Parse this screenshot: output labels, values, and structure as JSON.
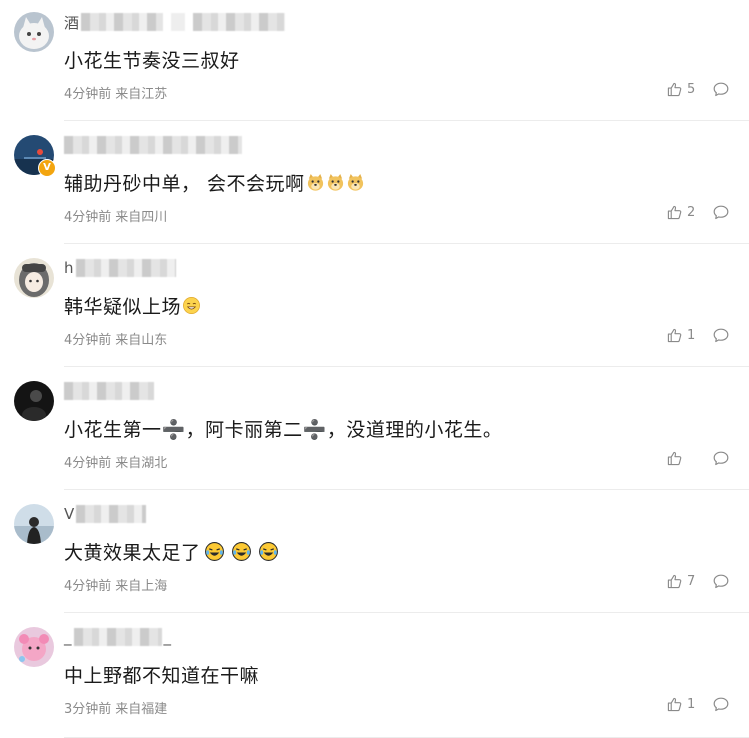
{
  "colors": {
    "text_primary": "#1a1a1a",
    "meta_gray": "#8a8a8a",
    "divider": "#ececec",
    "verified_badge": "#f3a50f"
  },
  "comments": [
    {
      "username_lead": "酒",
      "body": "小花生节奏没三叔好",
      "emojis": [],
      "time": "4分钟前",
      "location": "来自江苏",
      "likes": "5",
      "avatar_icon": "white-cat-avatar",
      "verified": false
    },
    {
      "username_lead": "",
      "body": "辅助丹砂中单， 会不会玩啊",
      "emojis": [
        "doge-icon",
        "doge-icon",
        "doge-icon"
      ],
      "time": "4分钟前",
      "location": "来自四川",
      "likes": "2",
      "avatar_icon": "blue-sky-avatar",
      "verified": true
    },
    {
      "username_lead": "h",
      "body": "韩华疑似上场",
      "emojis": [
        "grin-icon"
      ],
      "time": "4分钟前",
      "location": "来自山东",
      "likes": "1",
      "avatar_icon": "anime-girl-avatar",
      "verified": false
    },
    {
      "username_lead": "",
      "body": "小花生第一➗，阿卡丽第二➗，没道理的小花生。",
      "emojis": [],
      "time": "4分钟前",
      "location": "来自湖北",
      "likes": "",
      "avatar_icon": "dark-avatar",
      "verified": false
    },
    {
      "username_lead": "V",
      "body": "大黄效果太足了",
      "emojis": [
        "laugh-cry-icon",
        "laugh-cry-icon",
        "laugh-cry-icon"
      ],
      "time": "4分钟前",
      "location": "来自上海",
      "likes": "7",
      "avatar_icon": "beach-avatar",
      "verified": false
    },
    {
      "username_lead": "_",
      "body": "中上野都不知道在干嘛",
      "emojis": [],
      "time": "3分钟前",
      "location": "来自福建",
      "likes": "1",
      "avatar_icon": "pink-cartoon-avatar",
      "verified": false
    }
  ]
}
